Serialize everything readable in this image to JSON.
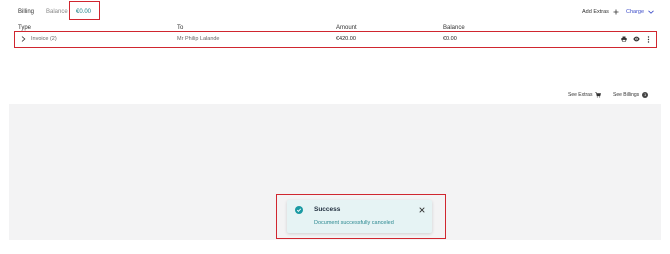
{
  "header": {
    "tab_billing": "Billing",
    "tab_balance": "Balance",
    "balance_value": "€0.00",
    "add_extras": "Add Extras",
    "charge": "Charge"
  },
  "table": {
    "columns": [
      "Type",
      "To",
      "Amount",
      "Balance"
    ],
    "rows": [
      {
        "type": "Invoice (2)",
        "to": "Mr Philip Lalande",
        "amount": "€420.00",
        "balance": "€0.00"
      }
    ]
  },
  "footer": {
    "see_extras": "See Extras",
    "see_billings": "See Billings",
    "billings_badge": "1"
  },
  "toast": {
    "title": "Success",
    "message": "Document successfully canceled"
  },
  "colors": {
    "accent": "#1a7f86",
    "highlight_border": "#d0262f",
    "charge": "#3b4bc8",
    "toast_bg": "#e6f3f4"
  }
}
